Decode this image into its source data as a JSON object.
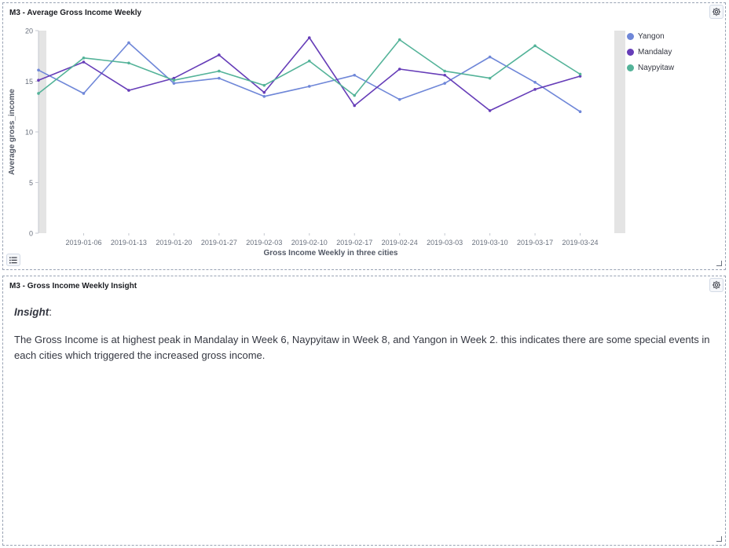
{
  "panel1": {
    "title": "M3 - Average Gross Income Weekly"
  },
  "panel2": {
    "title": "M3 - Gross Income Weekly Insight",
    "insight_label": "Insight",
    "insight_colon": ":",
    "insight_text": "The Gross Income is at highest peak in Mandalay in Week 6, Naypyitaw in Week 8, and Yangon in Week 2. this indicates there are some special events in each cities which triggered the increased gross income."
  },
  "icons": {
    "settings": "gear-icon",
    "legend_toggle": "list-icon",
    "resize": "resize-corner-icon"
  },
  "chart_data": {
    "type": "line",
    "xlabel": "Gross Income Weekly in three cities",
    "ylabel": "Average gross_income",
    "ylim": [
      0,
      20
    ],
    "yticks": [
      0,
      5,
      10,
      15,
      20
    ],
    "xticks": [
      "2019-01-06",
      "2019-01-13",
      "2019-01-20",
      "2019-01-27",
      "2019-02-03",
      "2019-02-10",
      "2019-02-17",
      "2019-02-24",
      "2019-03-03",
      "2019-03-10",
      "2019-03-17",
      "2019-03-24"
    ],
    "x": [
      "2018-12-30",
      "2019-01-06",
      "2019-01-13",
      "2019-01-20",
      "2019-01-27",
      "2019-02-03",
      "2019-02-10",
      "2019-02-17",
      "2019-02-24",
      "2019-03-03",
      "2019-03-10",
      "2019-03-17",
      "2019-03-24",
      "2019-03-31"
    ],
    "legend_position": "right",
    "series": [
      {
        "name": "Yangon",
        "color": "#6f87d8",
        "values": [
          16.1,
          13.8,
          18.8,
          14.8,
          15.3,
          13.5,
          14.5,
          15.6,
          13.2,
          14.8,
          17.4,
          14.9,
          12.0
        ]
      },
      {
        "name": "Mandalay",
        "color": "#663db8",
        "values": [
          15.1,
          16.9,
          14.1,
          15.3,
          17.6,
          13.9,
          19.3,
          12.6,
          16.2,
          15.6,
          12.1,
          14.2,
          15.5
        ]
      },
      {
        "name": "Naypyitaw",
        "color": "#54b399",
        "values": [
          13.8,
          17.3,
          16.8,
          15.1,
          16.0,
          14.6,
          17.0,
          13.6,
          19.1,
          16.0,
          15.3,
          18.5,
          15.7
        ]
      }
    ]
  }
}
